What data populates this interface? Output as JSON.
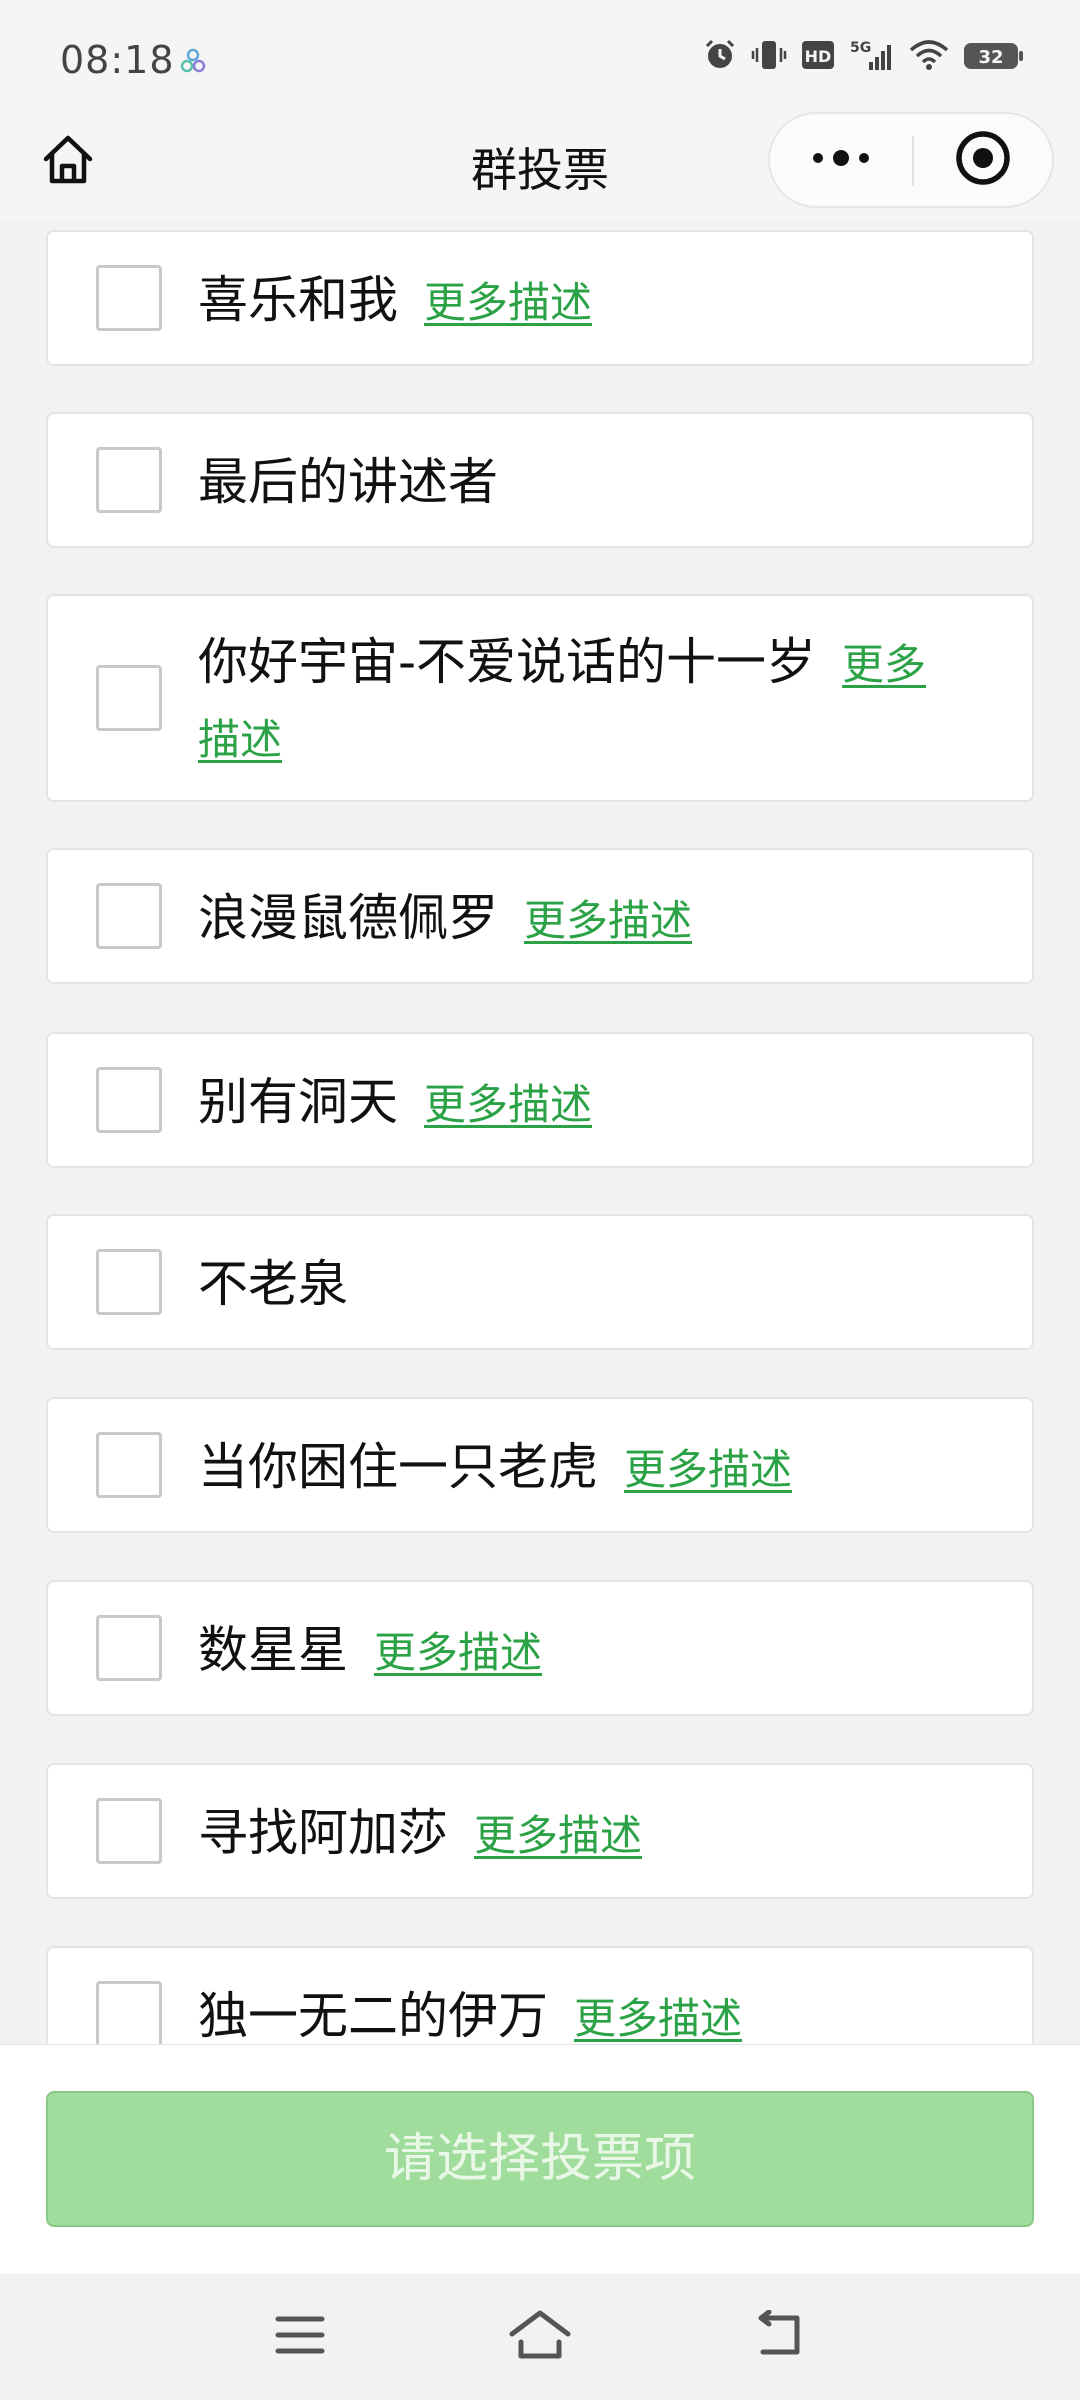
{
  "status_bar": {
    "time": "08:18",
    "icons": [
      "app-dots-icon",
      "alarm-icon",
      "vibrate-icon",
      "hd-icon",
      "5g-signal-icon",
      "wifi-icon",
      "battery-icon"
    ],
    "hd_label": "HD",
    "network_label": "5G",
    "battery_level": "32"
  },
  "nav": {
    "title": "群投票",
    "home_icon": "home-icon",
    "more_icon": "more-dots-icon",
    "close_icon": "target-close-icon"
  },
  "options": [
    {
      "label": "喜乐和我",
      "more": "更多描述",
      "checked": false
    },
    {
      "label": "最后的讲述者",
      "more": "",
      "checked": false
    },
    {
      "label": "你好宇宙-不爱说话的十一岁",
      "more": "更多描述",
      "checked": false
    },
    {
      "label": "浪漫鼠德佩罗",
      "more": "更多描述",
      "checked": false
    },
    {
      "label": "别有洞天",
      "more": "更多描述",
      "checked": false
    },
    {
      "label": "不老泉",
      "more": "",
      "checked": false
    },
    {
      "label": "当你困住一只老虎",
      "more": "更多描述",
      "checked": false
    },
    {
      "label": "数星星",
      "more": "更多描述",
      "checked": false
    },
    {
      "label": "寻找阿加莎",
      "more": "更多描述",
      "checked": false
    },
    {
      "label": "独一无二的伊万",
      "more": "更多描述",
      "checked": false
    }
  ],
  "submit": {
    "label": "请选择投票项",
    "enabled": false
  },
  "system_nav": {
    "icons": [
      "menu-icon",
      "home-outline-icon",
      "back-icon"
    ]
  },
  "colors": {
    "accent_link": "#2ba245",
    "submit_disabled_bg": "#a0dd9c",
    "page_bg": "#f2f2f2"
  }
}
